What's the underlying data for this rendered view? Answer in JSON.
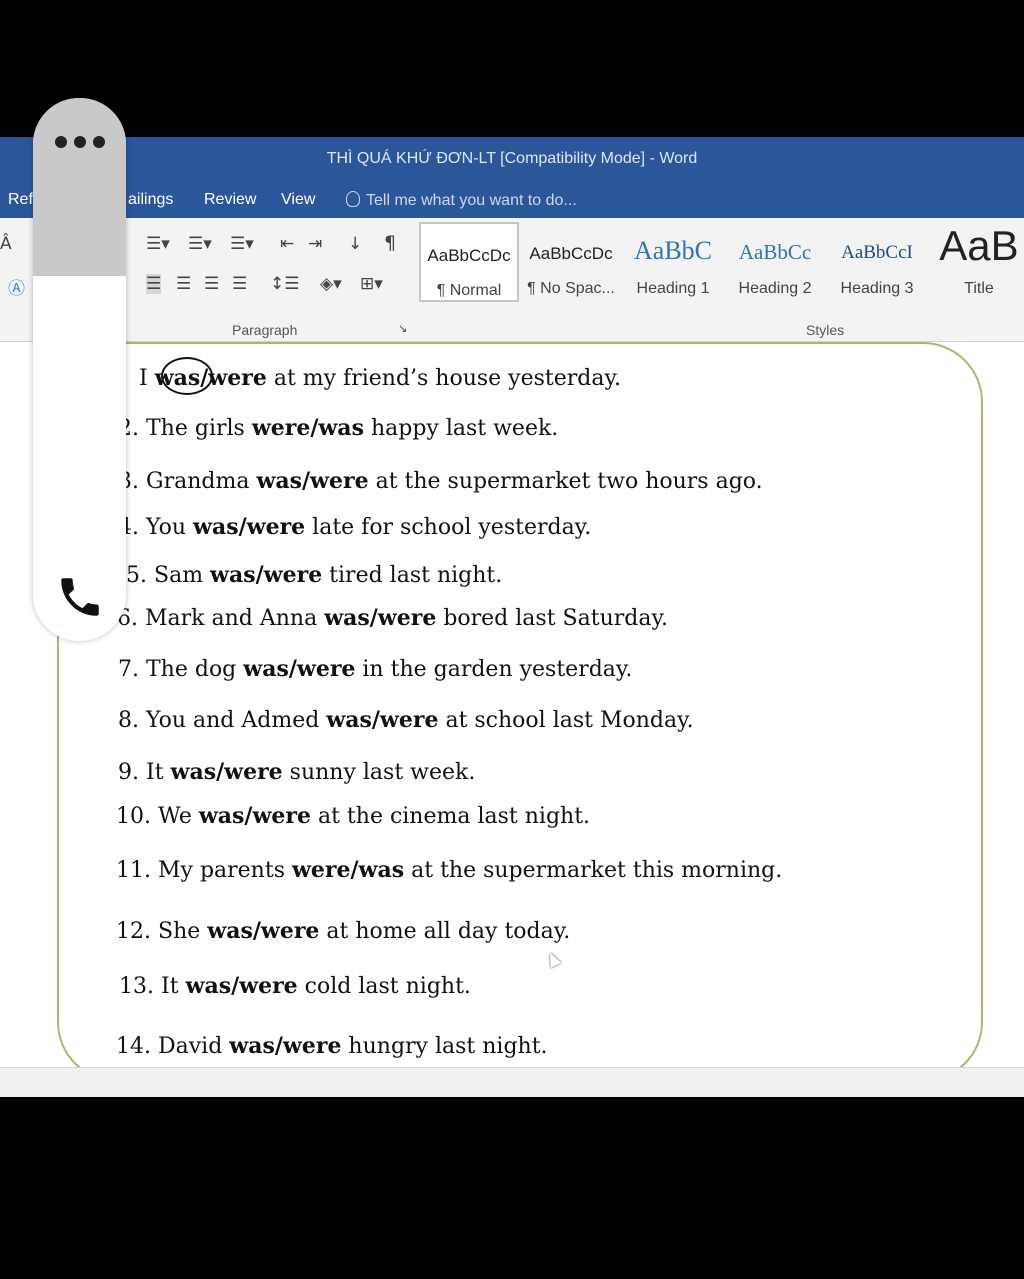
{
  "window": {
    "title": "THÌ QUÁ KHỨ ĐƠN-LT [Compatibility Mode] - Word"
  },
  "tabs": [
    {
      "label": "Ref"
    },
    {
      "label": "ailings"
    },
    {
      "label": "Review"
    },
    {
      "label": "View"
    }
  ],
  "tellme": {
    "text": "Tell me what you want to do..."
  },
  "ribbon": {
    "paragraph_label": "Paragraph",
    "styles_label": "Styles",
    "styles": [
      {
        "sample": "AaBbCcDc",
        "name": "¶ Normal"
      },
      {
        "sample": "AaBbCcDc",
        "name": "¶ No Spac..."
      },
      {
        "sample": "AaBbC",
        "name": "Heading 1"
      },
      {
        "sample": "AaBbCc",
        "name": "Heading 2"
      },
      {
        "sample": "AaBbCcI",
        "name": "Heading 3"
      },
      {
        "sample": "AaB",
        "name": "Title"
      }
    ]
  },
  "document": {
    "lines": [
      {
        "num": ".",
        "pre": "I ",
        "bold": "was/were",
        "post": " at my friend’s house yesterday."
      },
      {
        "num": "2.",
        "pre": "The girls ",
        "bold": "were/was",
        "post": " happy last week."
      },
      {
        "num": "3.",
        "pre": "Grandma ",
        "bold": "was/were",
        "post": " at the supermarket two hours ago."
      },
      {
        "num": "4.",
        "pre": "You ",
        "bold": "was/were",
        "post": " late for school yesterday."
      },
      {
        "num": "5.",
        "pre": "Sam ",
        "bold": "was/were",
        "post": " tired last night."
      },
      {
        "num": "6.",
        "pre": "Mark and Anna ",
        "bold": "was/were",
        "post": " bored last Saturday."
      },
      {
        "num": "7.",
        "pre": "The dog ",
        "bold": "was/were",
        "post": " in the garden yesterday."
      },
      {
        "num": "8.",
        "pre": "You and Admed ",
        "bold": "was/were",
        "post": " at school last Monday."
      },
      {
        "num": "9.",
        "pre": "It ",
        "bold": "was/were",
        "post": " sunny last week."
      },
      {
        "num": "10.",
        "pre": "We ",
        "bold": "was/were",
        "post": " at the cinema last night."
      },
      {
        "num": "11.",
        "pre": "My parents ",
        "bold": "were/was",
        "post": " at the supermarket this morning."
      },
      {
        "num": "12.",
        "pre": "She ",
        "bold": "was/were",
        "post": " at home all day today."
      },
      {
        "num": "13.",
        "pre": "It ",
        "bold": "was/were",
        "post": " cold last night."
      },
      {
        "num": "14.",
        "pre": "David ",
        "bold": "was/were",
        "post": " hungry last night."
      }
    ]
  },
  "overlay": {
    "menu_icon": "more-dots-icon",
    "call_icon": "phone-icon"
  },
  "colors": {
    "word_blue": "#2b579a",
    "frame_green": "#a7b86c"
  }
}
